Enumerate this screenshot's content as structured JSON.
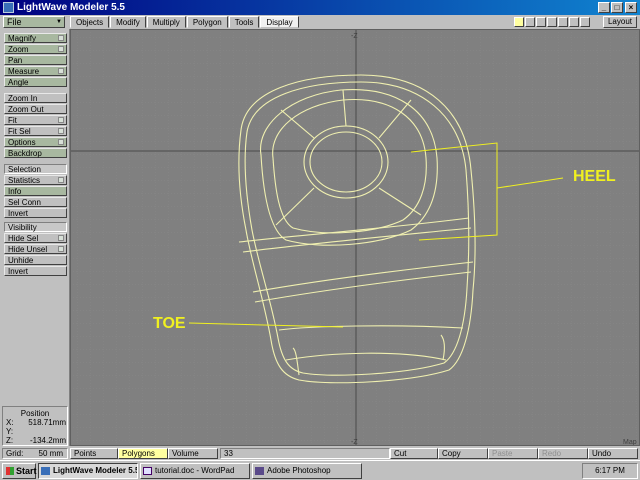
{
  "window": {
    "title": "LightWave Modeler 5.5",
    "minimize": "_",
    "maximize": "□",
    "close": "×"
  },
  "toolbar": {
    "file_label": "File",
    "tabs": [
      {
        "label": "Objects"
      },
      {
        "label": "Modify"
      },
      {
        "label": "Multiply"
      },
      {
        "label": "Polygon"
      },
      {
        "label": "Tools"
      },
      {
        "label": "Display",
        "active": true
      }
    ],
    "layout_label": "Layout"
  },
  "sidebar": {
    "view": [
      "Magnify",
      "Zoom",
      "Pan",
      "Measure",
      "Angle"
    ],
    "zoom": [
      "Zoom In",
      "Zoom Out",
      "Fit",
      "Fit Sel",
      "Options",
      "Backdrop"
    ],
    "selection": [
      "Selection",
      "Statistics",
      "Info",
      "Sel Conn",
      "Invert"
    ],
    "visibility": [
      "Visibility",
      "Hide Sel",
      "Hide Unsel",
      "Unhide",
      "Invert"
    ]
  },
  "position": {
    "title": "Position",
    "x_label": "X:",
    "x": "518.71mm",
    "y_label": "Y:",
    "y": "",
    "z_label": "Z:",
    "z": "-134.2mm"
  },
  "viewport": {
    "axis_top": "-Z",
    "axis_bottom": "-Z",
    "corner_label": "Map",
    "label_heel": "HEEL",
    "label_toe": "TOE",
    "line_color": "#f0f0b0",
    "annotation_color": "#f0f020"
  },
  "statusbar": {
    "grid_label": "Grid:",
    "grid_value": "50 mm",
    "points": "Points",
    "polygons": "Polygons",
    "volume": "Volume",
    "count": "33",
    "cut": "Cut",
    "copy": "Copy",
    "paste": "Paste",
    "redo": "Redo",
    "undo": "Undo"
  },
  "taskbar": {
    "start": "Start",
    "tasks": [
      "LightWave Modeler 5.5",
      "tutorial.doc - WordPad",
      "Adobe Photoshop"
    ],
    "clock": "6:17 PM"
  }
}
